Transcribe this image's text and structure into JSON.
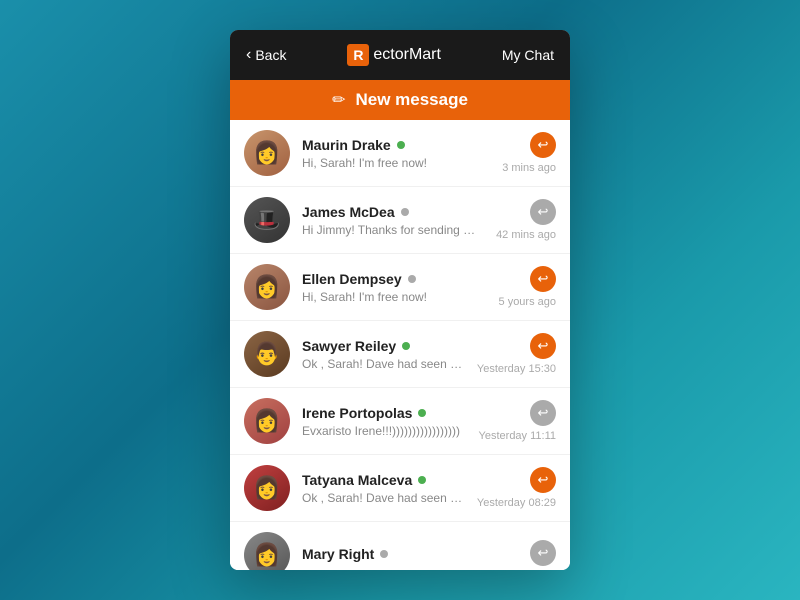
{
  "header": {
    "back_label": "Back",
    "logo_r": "R",
    "logo_text": "ectorMart",
    "my_chat_label": "My Chat"
  },
  "new_message_bar": {
    "label": "New message"
  },
  "chats": [
    {
      "id": 1,
      "name": "Maurin Drake",
      "preview": "Hi, Sarah! I'm free now!",
      "time": "3 mins ago",
      "status": "online",
      "reply_style": "orange",
      "avatar_class": "avatar-1",
      "avatar_emoji": "👩"
    },
    {
      "id": 2,
      "name": "James McDea",
      "preview": "Hi Jimmy! Thanks for sending me the link)))",
      "time": "42 mins ago",
      "status": "offline",
      "reply_style": "gray",
      "avatar_class": "avatar-2",
      "avatar_emoji": "🎩"
    },
    {
      "id": 3,
      "name": "Ellen Dempsey",
      "preview": "Hi, Sarah! I'm free now!",
      "time": "5 yours ago",
      "status": "offline",
      "reply_style": "orange",
      "avatar_class": "avatar-3",
      "avatar_emoji": "👩"
    },
    {
      "id": 4,
      "name": "Sawyer Reiley",
      "preview": "Ok , Sarah! Dave had seen the mockup s...",
      "time": "Yesterday 15:30",
      "status": "online",
      "reply_style": "orange",
      "avatar_class": "avatar-4",
      "avatar_emoji": "👨"
    },
    {
      "id": 5,
      "name": "Irene Portopolas",
      "preview": "Evxaristo Irene!!!)))))))))))))))))",
      "time": "Yesterday 11:11",
      "status": "online",
      "reply_style": "gray",
      "avatar_class": "avatar-5",
      "avatar_emoji": "👩"
    },
    {
      "id": 6,
      "name": "Tatyana Malceva",
      "preview": "Ok , Sarah! Dave had seen the mockup s...",
      "time": "Yesterday 08:29",
      "status": "online",
      "reply_style": "orange",
      "avatar_class": "avatar-6",
      "avatar_emoji": "👩"
    },
    {
      "id": 7,
      "name": "Mary Right",
      "preview": "",
      "time": "",
      "status": "offline",
      "reply_style": "gray",
      "avatar_class": "avatar-7",
      "avatar_emoji": "👩"
    }
  ]
}
